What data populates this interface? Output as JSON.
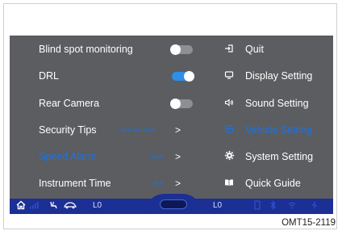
{
  "settings": {
    "blind_spot": {
      "label": "Blind spot monitoring",
      "enabled": false
    },
    "drl": {
      "label": "DRL",
      "enabled": true
    },
    "rear_camera": {
      "label": "Rear Camera",
      "enabled": false
    },
    "security_tips": {
      "label": "Security Tips",
      "value": "Lights and Horn",
      "chevron": ">"
    },
    "speed_alarm": {
      "label": "Speed Alarm",
      "value": "Close",
      "chevron": ">"
    },
    "instrument_time": {
      "label": "Instrument Time",
      "value": "04:27",
      "chevron": ">"
    }
  },
  "menu": [
    {
      "label": "Quit",
      "icon": "quit-icon",
      "active": false
    },
    {
      "label": "Display Setting",
      "icon": "display-icon",
      "active": false
    },
    {
      "label": "Sound Setting",
      "icon": "speaker-icon",
      "active": false
    },
    {
      "label": "Vehicle Setting",
      "icon": "vehicle-icon",
      "active": true
    },
    {
      "label": "System Setting",
      "icon": "gear-icon",
      "active": false
    },
    {
      "label": "Quick Guide",
      "icon": "book-icon",
      "active": false
    }
  ],
  "status_bar": {
    "left_value": "L0",
    "right_value": "L0"
  },
  "caption": "OMT15-2119",
  "colors": {
    "panel": "#5b5d60",
    "accent": "#1a73e8",
    "bar": "#1c2f94"
  }
}
